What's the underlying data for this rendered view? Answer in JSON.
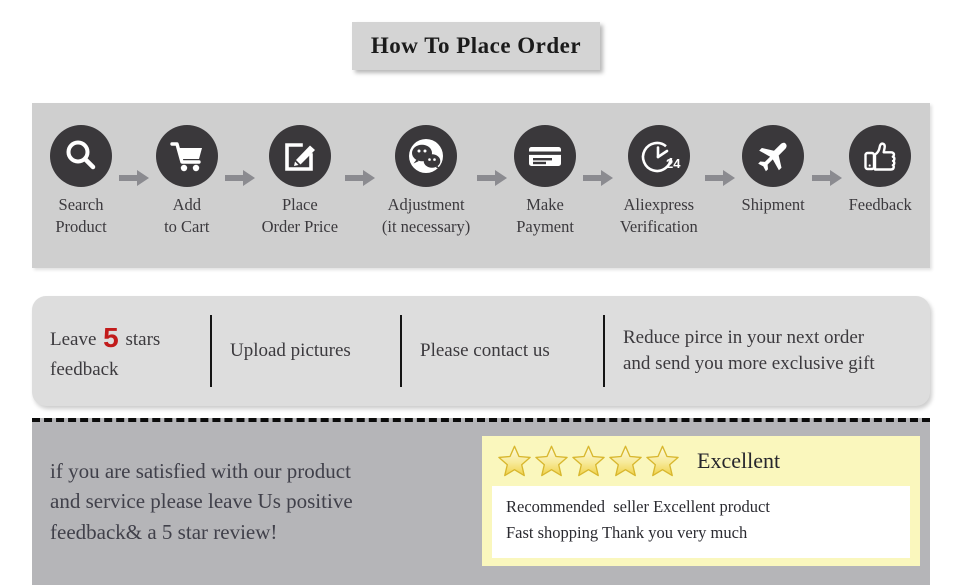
{
  "header": {
    "title": "How To Place Order"
  },
  "steps": {
    "arrow_icon": "arrow-right-icon",
    "items": [
      {
        "icon": "search-icon",
        "label": "Search\nProduct"
      },
      {
        "icon": "shopping-cart-icon",
        "label": "Add\nto Cart"
      },
      {
        "icon": "edit-square-icon",
        "label": "Place\nOrder Price"
      },
      {
        "icon": "wechat-chat-icon",
        "label": "Adjustment\n(it necessary)"
      },
      {
        "icon": "credit-card-icon",
        "label": "Make\nPayment"
      },
      {
        "icon": "clock-24-icon",
        "label": "Aliexpress\nVerification"
      },
      {
        "icon": "airplane-icon",
        "label": "Shipment"
      },
      {
        "icon": "thumbs-up-icon",
        "label": "Feedback"
      }
    ]
  },
  "promises": {
    "cells": [
      {
        "before": "Leave ",
        "highlight": "5",
        "after": " stars\nfeedback"
      },
      {
        "before": "Upload pictures",
        "highlight": "",
        "after": ""
      },
      {
        "before": "Please contact us",
        "highlight": "",
        "after": ""
      },
      {
        "before": "Reduce pirce in your next order\nand send you more exclusive gift",
        "highlight": "",
        "after": ""
      }
    ]
  },
  "bottom": {
    "message": "if you are satisfied with our product\nand service please leave Us positive\nfeedback& a 5 star review!"
  },
  "review": {
    "star_count": 5,
    "star_icon": "star-icon",
    "rating_label": "Excellent",
    "lines": [
      "Recommended  seller Excellent product",
      "Fast shopping Thank you very much"
    ]
  },
  "colors": {
    "accent_red": "#c21b1b",
    "icon_dark": "#3a383b",
    "panel_light": "#cfcfcf",
    "panel_promise": "#dddddd",
    "panel_bottom": "#b5b5b8",
    "review_yellow": "#faf7bd",
    "star_gold": "#e8c33a"
  }
}
